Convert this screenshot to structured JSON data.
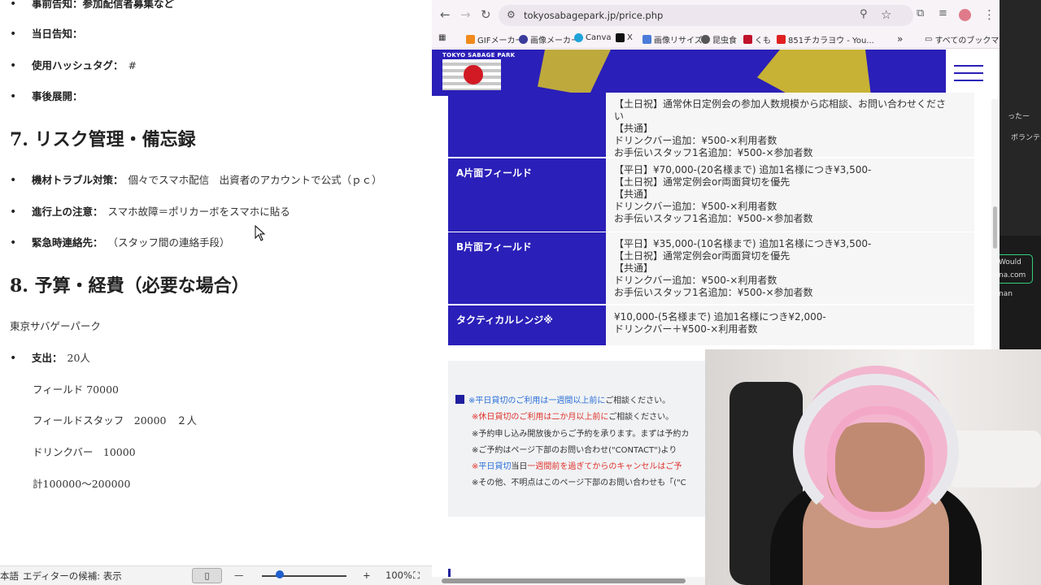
{
  "document": {
    "top_cut_text": "事前告知：参加配信者募集など",
    "bullets_top": [
      {
        "label": "当日告知：",
        "value": ""
      },
      {
        "label": "使用ハッシュタグ：",
        "value": "#"
      },
      {
        "label": "事後展開：",
        "value": ""
      }
    ],
    "section7_title": "7. リスク管理・備忘録",
    "bullets_risk": [
      {
        "label": "機材トラブル対策：",
        "value": "個々でスマホ配信　出資者のアカウントで公式（ｐｃ）"
      },
      {
        "label": "進行上の注意：",
        "value": "スマホ故障＝ポリカーボをスマホに貼る"
      },
      {
        "label": "緊急時連絡先：",
        "value": "（スタッフ間の連絡手段）"
      }
    ],
    "section8_title": "8. 予算・経費（必要な場合）",
    "venue": "東京サバゲーパーク",
    "expense_label": "支出：",
    "expense_value": "20人",
    "expense_items": [
      "フィールド 70000",
      "フィールドスタッフ　20000　２人",
      "ドリンクバー　10000",
      "計100000～200000"
    ]
  },
  "statusbar": {
    "language": "本語",
    "editor_suggestions": "エディターの候補: 表示",
    "zoom": "100%",
    "minus": "—",
    "plus": "+"
  },
  "browser": {
    "url": "tokyosabagepark.jp/price.php",
    "bookmarks": [
      {
        "label": "GIFメーカー",
        "color": "#f08a1c"
      },
      {
        "label": "画像メーカー",
        "color": "#3a3a9a"
      },
      {
        "label": "Canva",
        "color": "#1fa3d8"
      },
      {
        "label": "X",
        "color": "#111111"
      },
      {
        "label": "画像リサイズ",
        "color": "#4a7bd8"
      },
      {
        "label": "昆虫食",
        "color": "#555555"
      },
      {
        "label": "くも",
        "color": "#c0122a"
      },
      {
        "label": "851チカラヨウ - You...",
        "color": "#e02020"
      }
    ],
    "bookmarks_more": "»",
    "all_bookmarks": "すべてのブックマーク"
  },
  "site": {
    "logo_text": "TOKYO SABAGE PARK",
    "price_rows": [
      {
        "label": "",
        "lines": [
          "【土日祝】通常休日定例会の参加人数規模から応相談、お問い合わせくださ",
          "い",
          "【共通】",
          "ドリンクバー追加：¥500-×利用者数",
          "お手伝いスタッフ1名追加：¥500-×参加者数"
        ]
      },
      {
        "label": "A片面フィールド",
        "lines": [
          "【平日】¥70,000-(20名様まで) 追加1名様につき¥3,500-",
          "【土日祝】通常定例会or両面貸切を優先",
          "【共通】",
          "ドリンクバー追加：¥500-×利用者数",
          "お手伝いスタッフ1名追加：¥500-×参加者数"
        ]
      },
      {
        "label": "B片面フィールド",
        "lines": [
          "【平日】¥35,000-(10名様まで) 追加1名様につき¥3,500-",
          "【土日祝】通常定例会or両面貸切を優先",
          "【共通】",
          "ドリンクバー追加：¥500-×利用者数",
          "お手伝いスタッフ1名追加：¥500-×参加者数"
        ]
      },
      {
        "label": "タクティカルレンジ※",
        "lines": [
          "¥10,000-(5名様まで) 追加1名様につき¥2,000-",
          "ドリンクバー＋¥500-×利用者数"
        ]
      }
    ],
    "notes": {
      "n1_blue": "※平日貸切のご利用は一週間以上前に",
      "n1_rest": "ご相談ください。",
      "n2_red": "※休日貸切のご利用は二か月以上前に",
      "n2_rest": "ご相談ください。",
      "n3": "※予約申し込み開放後からご予約を承ります。まずは予約カ",
      "n4": "※ご予約はページ下部のお問い合わせ(\"CONTACT\")より",
      "n5_a": "※",
      "n5_blue": "平日貸切",
      "n5_mid": "当日",
      "n5_red": "一週間前を過ぎてからのキャンセルはご予",
      "n6": "※その他、不明点はこのページ下部のお問い合わせも「(\"C"
    }
  },
  "side_app": {
    "t1": "ったー",
    "t2": "ボランティア",
    "t3": "Would",
    "t4": "na.com",
    "t5": "nan"
  }
}
